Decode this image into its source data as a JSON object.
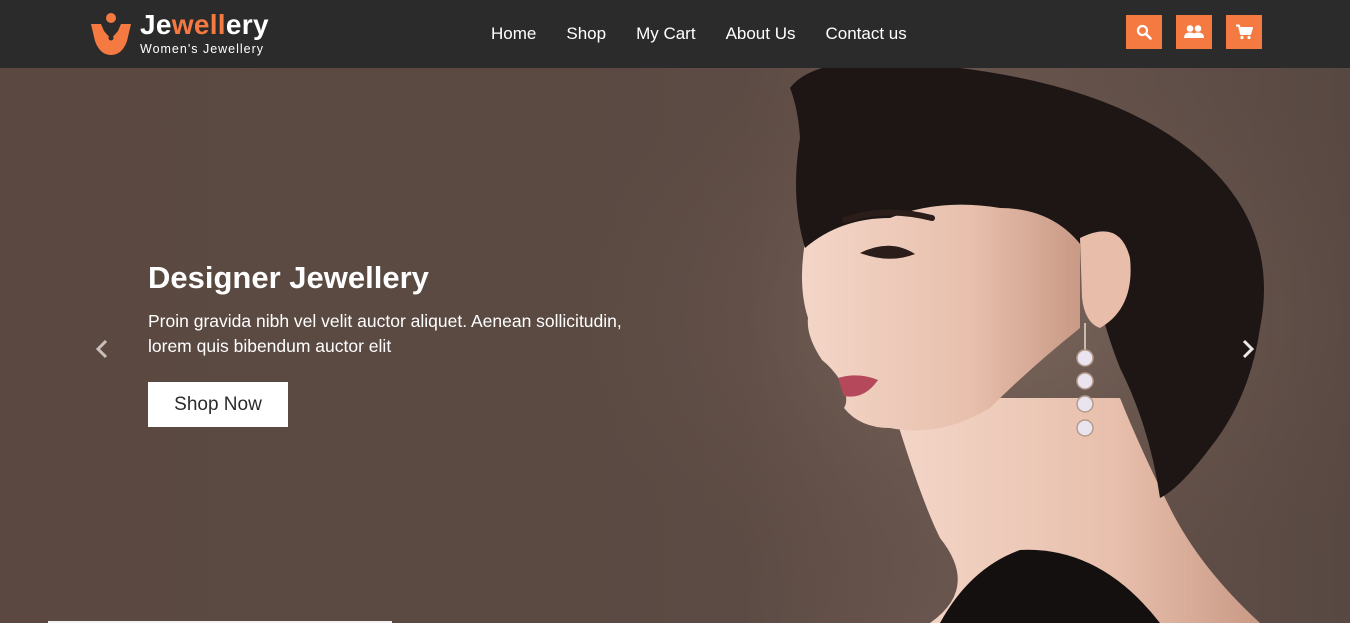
{
  "brand": {
    "title_part1": "Je",
    "title_accent": "well",
    "title_part2": "ery",
    "subtitle": "Women's Jewellery",
    "accent_color": "#f47a42"
  },
  "nav": {
    "items": [
      {
        "label": "Home"
      },
      {
        "label": "Shop"
      },
      {
        "label": "My Cart"
      },
      {
        "label": "About Us"
      },
      {
        "label": "Contact us"
      }
    ]
  },
  "actions": {
    "icons": [
      "search-icon",
      "users-icon",
      "cart-icon"
    ]
  },
  "hero": {
    "title": "Designer Jewellery",
    "text": "Proin gravida nibh vel velit auctor aliquet. Aenean sollicitudin, lorem quis bibendum auctor elit",
    "button_label": "Shop Now"
  },
  "colors": {
    "header_bg": "#2c2b2b",
    "hero_bg": "#5a4840"
  }
}
